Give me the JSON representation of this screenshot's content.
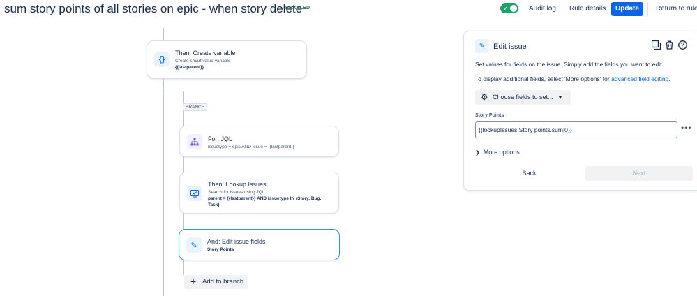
{
  "header": {
    "title": "sum story points of all stories on epic - when story delete",
    "status": "ENABLED",
    "audit_log": "Audit log",
    "rule_details": "Rule details",
    "update": "Update",
    "return": "Return to rules"
  },
  "canvas": {
    "create_variable": {
      "title": "Then: Create variable",
      "sub": "Create smart value variable",
      "value": "{{lastparent}}",
      "icon": "variable-braces-icon"
    },
    "branch_label": "BRANCH",
    "for_jql": {
      "title": "For: JQL",
      "sub": "issuetype = epic AND issue = {{lastparent}}",
      "icon": "hierarchy-icon"
    },
    "lookup": {
      "title": "Then: Lookup Issues",
      "sub": "Search for issues using JQL",
      "query": "parent = {{lastparent}} AND issuetype IN (Story, Bug, Task)",
      "icon": "lookup-icon"
    },
    "edit_fields": {
      "title": "And: Edit issue fields",
      "sub": "Story Points",
      "icon": "pencil-icon"
    },
    "add_branch": "Add to branch"
  },
  "panel": {
    "title": "Edit issue",
    "desc1": "Set values for fields on the issue. Simply add the fields you want to edit.",
    "desc2_prefix": "To display additional fields, select 'More options' for ",
    "desc2_link": "advanced field editing",
    "desc2_suffix": ".",
    "choose_fields": "Choose fields to set...",
    "field_label": "Story Points",
    "field_value": "{{lookupIssues.Story points.sum|0}}",
    "more_options": "More options",
    "back": "Back",
    "next": "Next"
  },
  "colors": {
    "accent": "#0c66e4",
    "toggle_on": "#22a06b",
    "selected_border": "#388bff"
  }
}
